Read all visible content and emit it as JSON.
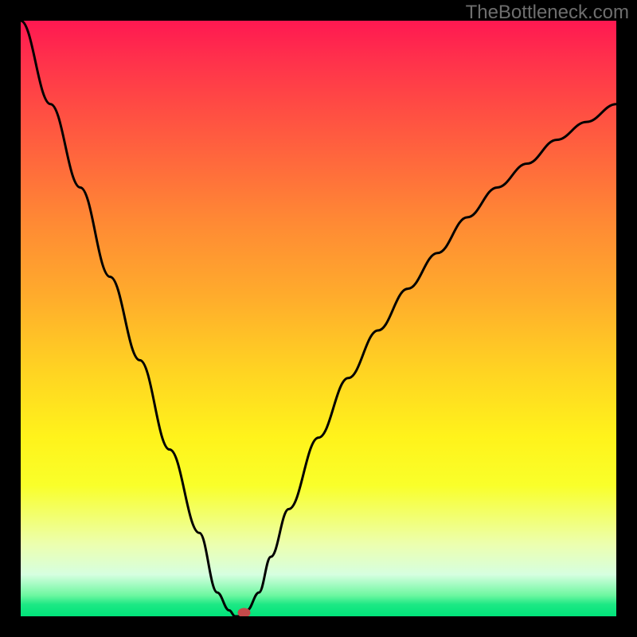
{
  "watermark": "TheBottleneck.com",
  "chart_data": {
    "type": "line",
    "title": "",
    "xlabel": "",
    "ylabel": "",
    "xlim": [
      0,
      100
    ],
    "ylim": [
      0,
      100
    ],
    "series": [
      {
        "name": "bottleneck-curve",
        "x": [
          0,
          5,
          10,
          15,
          20,
          25,
          30,
          33,
          35,
          36,
          37,
          38,
          40,
          42,
          45,
          50,
          55,
          60,
          65,
          70,
          75,
          80,
          85,
          90,
          95,
          100
        ],
        "values": [
          100,
          86,
          72,
          57,
          43,
          28,
          14,
          4,
          1,
          0,
          0,
          1,
          4,
          10,
          18,
          30,
          40,
          48,
          55,
          61,
          67,
          72,
          76,
          80,
          83,
          86
        ]
      }
    ],
    "marker": {
      "x": 37.5,
      "y": 0.6
    },
    "gradient_stops": [
      {
        "pos": 0.0,
        "color": "#ff1851"
      },
      {
        "pos": 0.5,
        "color": "#ffab2c"
      },
      {
        "pos": 0.78,
        "color": "#f9ff2a"
      },
      {
        "pos": 1.0,
        "color": "#00e47a"
      }
    ]
  }
}
